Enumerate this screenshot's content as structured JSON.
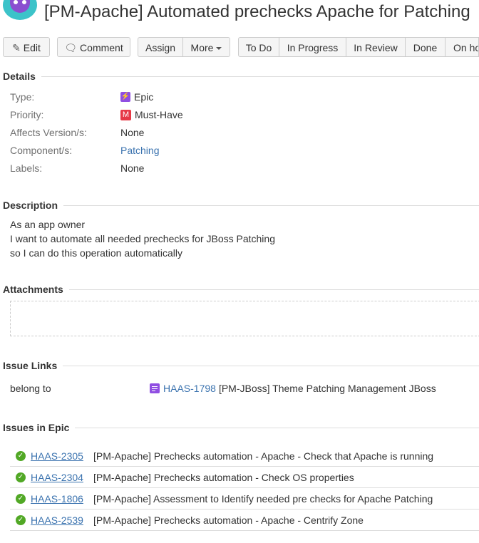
{
  "issue": {
    "title": "[PM-Apache] Automated prechecks Apache for Patching"
  },
  "toolbar": {
    "edit": "Edit",
    "comment": "Comment",
    "assign": "Assign",
    "more": "More",
    "todo": "To Do",
    "in_progress": "In Progress",
    "in_review": "In Review",
    "done": "Done",
    "on_hold": "On hold"
  },
  "details": {
    "heading": "Details",
    "type_label": "Type:",
    "type_value": "Epic",
    "priority_label": "Priority:",
    "priority_value": "Must-Have",
    "priority_letter": "M",
    "affects_label": "Affects Version/s:",
    "affects_value": "None",
    "component_label": "Component/s:",
    "component_value": "Patching",
    "labels_label": "Labels:",
    "labels_value": "None"
  },
  "description": {
    "heading": "Description",
    "line1": "As an app owner",
    "line2": "I want to automate all needed prechecks for JBoss Patching",
    "line3": "so I can do this operation automatically"
  },
  "attachments": {
    "heading": "Attachments"
  },
  "issue_links": {
    "heading": "Issue Links",
    "relation": "belong to",
    "key": "HAAS-1798",
    "summary": "[PM-JBoss] Theme Patching Management JBoss"
  },
  "issues_in_epic": {
    "heading": "Issues in Epic",
    "items": [
      {
        "key": "HAAS-2305",
        "summary": "[PM-Apache] Prechecks automation - Apache - Check that Apache is running"
      },
      {
        "key": "HAAS-2304",
        "summary": "[PM-Apache] Prechecks automation - Check OS properties"
      },
      {
        "key": "HAAS-1806",
        "summary": "[PM-Apache] Assessment to Identify needed pre checks for Apache Patching"
      },
      {
        "key": "HAAS-2539",
        "summary": "[PM-Apache] Prechecks automation - Apache - Centrify Zone"
      }
    ]
  },
  "colors": {
    "link": "#3b73af",
    "epic": "#904ee2",
    "priority": "#e63946",
    "done_check": "#51a825",
    "avatar": "#3cc3c9"
  }
}
